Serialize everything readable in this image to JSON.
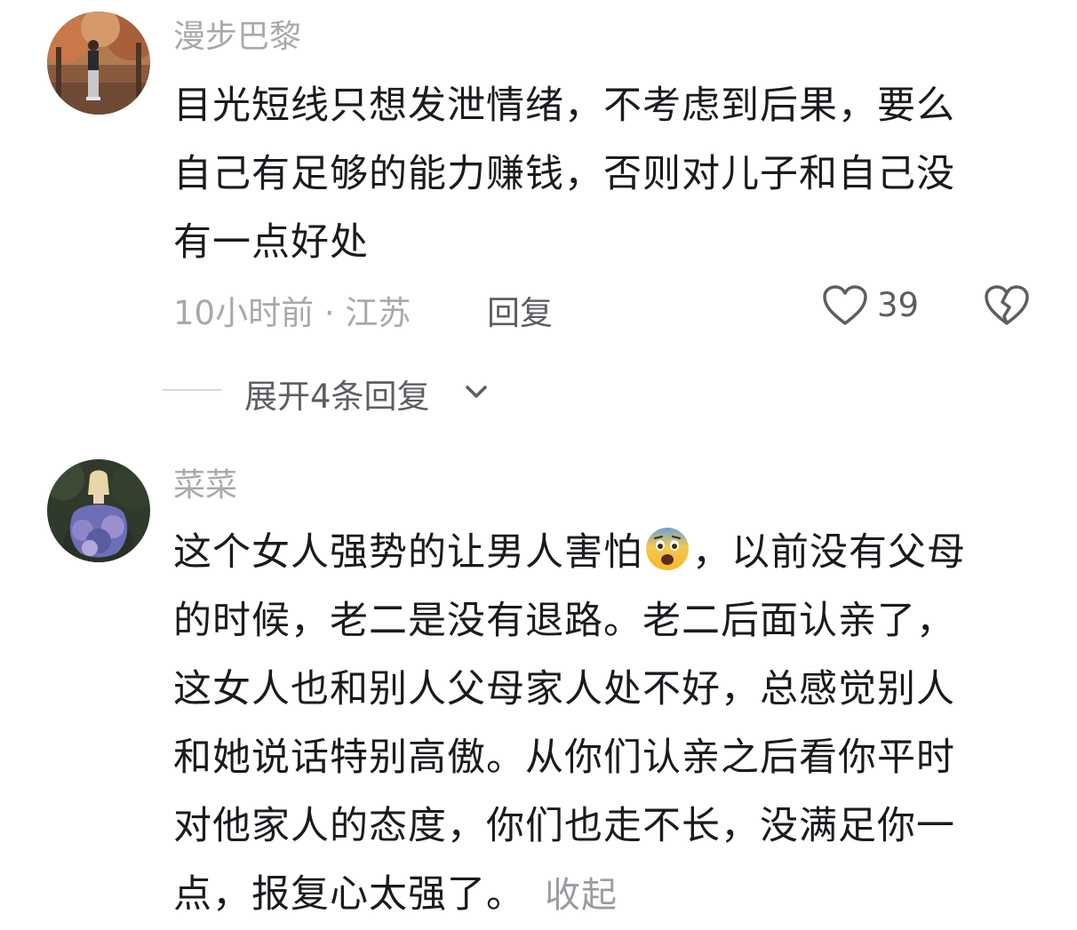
{
  "comments": [
    {
      "username": "漫步巴黎",
      "lines": [
        "目光短线只想发泄情绪，不考虑到后果，要么",
        "自己有足够的能力赚钱，否则对儿子和自己没",
        "有一点好处"
      ],
      "time_location": "10小时前 · 江苏",
      "reply_label": "回复",
      "like_count": "39",
      "expand_label": "展开4条回复"
    },
    {
      "username": "菜菜",
      "line1_before_emoji": "这个女人强势的让男人害怕",
      "line1_emoji": "fearful-face-emoji",
      "line1_after_emoji": "，以前没有父母",
      "lines": [
        "的时候，老二是没有退路。老二后面认亲了，",
        "这女人也和别人父母家人处不好，总感觉别人",
        "和她说话特别高傲。从你们认亲之后看你平时",
        "对他家人的态度，你们也走不长，没满足你一"
      ],
      "last_line": "点，报复心太强了。",
      "collapse_label": "收起"
    }
  ],
  "icons": {
    "like": "heart-outline-icon",
    "dislike": "broken-heart-icon",
    "expand": "chevron-down-icon"
  },
  "colors": {
    "username": "#a8a9ad",
    "body_text": "#1a1a1f",
    "secondary_text": "#5d5e63"
  }
}
